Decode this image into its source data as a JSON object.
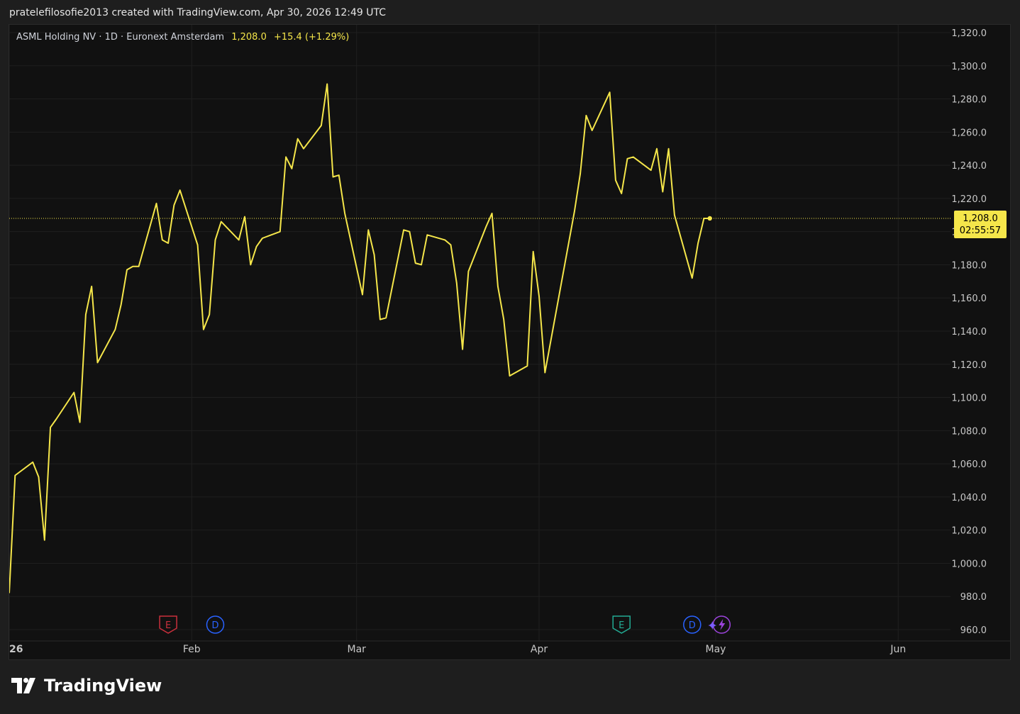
{
  "attribution": "pratelefilosofie2013 created with TradingView.com, Apr 30, 2026 12:49 UTC",
  "legend": {
    "symbol": "ASML Holding NV · 1D · Euronext Amsterdam",
    "price": "1,208.0",
    "change": "+15.4 (+1.29%)"
  },
  "price_label": {
    "price": "1,208.0",
    "countdown": "02:55:57"
  },
  "brand": {
    "name": "TradingView",
    "logo_icon": "tradingview-logo-icon"
  },
  "colors": {
    "line": "#f5e64a",
    "background": "#111111",
    "grid": "#1f1f1f",
    "earnings_past": "#c9303c",
    "earnings_future": "#22ab94",
    "dividend": "#2962ff",
    "split": "#9c44dc"
  },
  "events": [
    {
      "type": "earnings",
      "letter": "E",
      "date": "2026-01-28",
      "icon": "earnings-icon",
      "color": "#c9303c"
    },
    {
      "type": "dividend",
      "letter": "D",
      "date": "2026-02-05",
      "icon": "dividend-icon",
      "color": "#2962ff"
    },
    {
      "type": "earnings",
      "letter": "E",
      "date": "2026-04-15",
      "icon": "earnings-icon",
      "color": "#22ab94"
    },
    {
      "type": "dividend",
      "letter": "D",
      "date": "2026-04-27",
      "icon": "dividend-icon",
      "color": "#2962ff"
    },
    {
      "type": "split",
      "letter": "",
      "date": "2026-05-02",
      "icon": "sparkle-bolt-icon",
      "color": "#9c44dc"
    }
  ],
  "chart_data": {
    "type": "line",
    "title": "ASML Holding NV · 1D · Euronext Amsterdam",
    "x_axis_type": "date",
    "x": [
      "2026-01-01",
      "2026-01-02",
      "2026-01-05",
      "2026-01-06",
      "2026-01-07",
      "2026-01-08",
      "2026-01-09",
      "2026-01-12",
      "2026-01-13",
      "2026-01-14",
      "2026-01-15",
      "2026-01-16",
      "2026-01-19",
      "2026-01-20",
      "2026-01-21",
      "2026-01-22",
      "2026-01-23",
      "2026-01-26",
      "2026-01-27",
      "2026-01-28",
      "2026-01-29",
      "2026-01-30",
      "2026-02-02",
      "2026-02-03",
      "2026-02-04",
      "2026-02-05",
      "2026-02-06",
      "2026-02-09",
      "2026-02-10",
      "2026-02-11",
      "2026-02-12",
      "2026-02-13",
      "2026-02-16",
      "2026-02-17",
      "2026-02-18",
      "2026-02-19",
      "2026-02-20",
      "2026-02-23",
      "2026-02-24",
      "2026-02-25",
      "2026-02-26",
      "2026-02-27",
      "2026-03-02",
      "2026-03-03",
      "2026-03-04",
      "2026-03-05",
      "2026-03-06",
      "2026-03-09",
      "2026-03-10",
      "2026-03-11",
      "2026-03-12",
      "2026-03-13",
      "2026-03-16",
      "2026-03-17",
      "2026-03-18",
      "2026-03-19",
      "2026-03-20",
      "2026-03-23",
      "2026-03-24",
      "2026-03-25",
      "2026-03-26",
      "2026-03-27",
      "2026-03-30",
      "2026-03-31",
      "2026-04-01",
      "2026-04-02",
      "2026-04-07",
      "2026-04-08",
      "2026-04-09",
      "2026-04-10",
      "2026-04-13",
      "2026-04-14",
      "2026-04-15",
      "2026-04-16",
      "2026-04-17",
      "2026-04-20",
      "2026-04-21",
      "2026-04-22",
      "2026-04-23",
      "2026-04-24",
      "2026-04-27",
      "2026-04-28",
      "2026-04-29",
      "2026-04-30"
    ],
    "series": [
      {
        "values": [
          982,
          1053,
          1061,
          1052,
          1014,
          1082,
          1087,
          1103,
          1085,
          1150,
          1167,
          1121,
          1141,
          1156,
          1177,
          1179,
          1179,
          1217,
          1195,
          1193,
          1216,
          1225,
          1192,
          1141,
          1150,
          1195,
          1206,
          1195,
          1209,
          1180,
          1191,
          1196,
          1200,
          1245,
          1238,
          1256,
          1250,
          1264,
          1289,
          1233,
          1234,
          1211,
          1162,
          1201,
          1186,
          1147,
          1148,
          1201,
          1200,
          1181,
          1180,
          1198,
          1195,
          1192,
          1169,
          1129,
          1176,
          1203,
          1211,
          1167,
          1147,
          1113,
          1119,
          1188,
          1161,
          1115,
          1212,
          1235,
          1270,
          1261,
          1284,
          1231,
          1223,
          1244,
          1245,
          1237,
          1250,
          1224,
          1250,
          1210,
          1172,
          1193,
          1208,
          1208
        ]
      }
    ],
    "ylim": [
      955,
      1326
    ],
    "y_ticks": [
      "1,320.0",
      "1,300.0",
      "1,280.0",
      "1,260.0",
      "1,240.0",
      "1,220.0",
      "1,200.0",
      "1,180.0",
      "1,160.0",
      "1,140.0",
      "1,120.0",
      "1,100.0",
      "1,080.0",
      "1,060.0",
      "1,040.0",
      "1,020.0",
      "1,000.0",
      "980.0",
      "960.0"
    ],
    "x_ticks": [
      {
        "label": "26",
        "date": "2026-01-01"
      },
      {
        "label": "Feb",
        "date": "2026-02-01"
      },
      {
        "label": "Mar",
        "date": "2026-03-01"
      },
      {
        "label": "Apr",
        "date": "2026-04-01"
      },
      {
        "label": "May",
        "date": "2026-05-01"
      },
      {
        "label": "Jun",
        "date": "2026-06-01"
      }
    ],
    "last_price_line": 1208,
    "grid": true
  }
}
